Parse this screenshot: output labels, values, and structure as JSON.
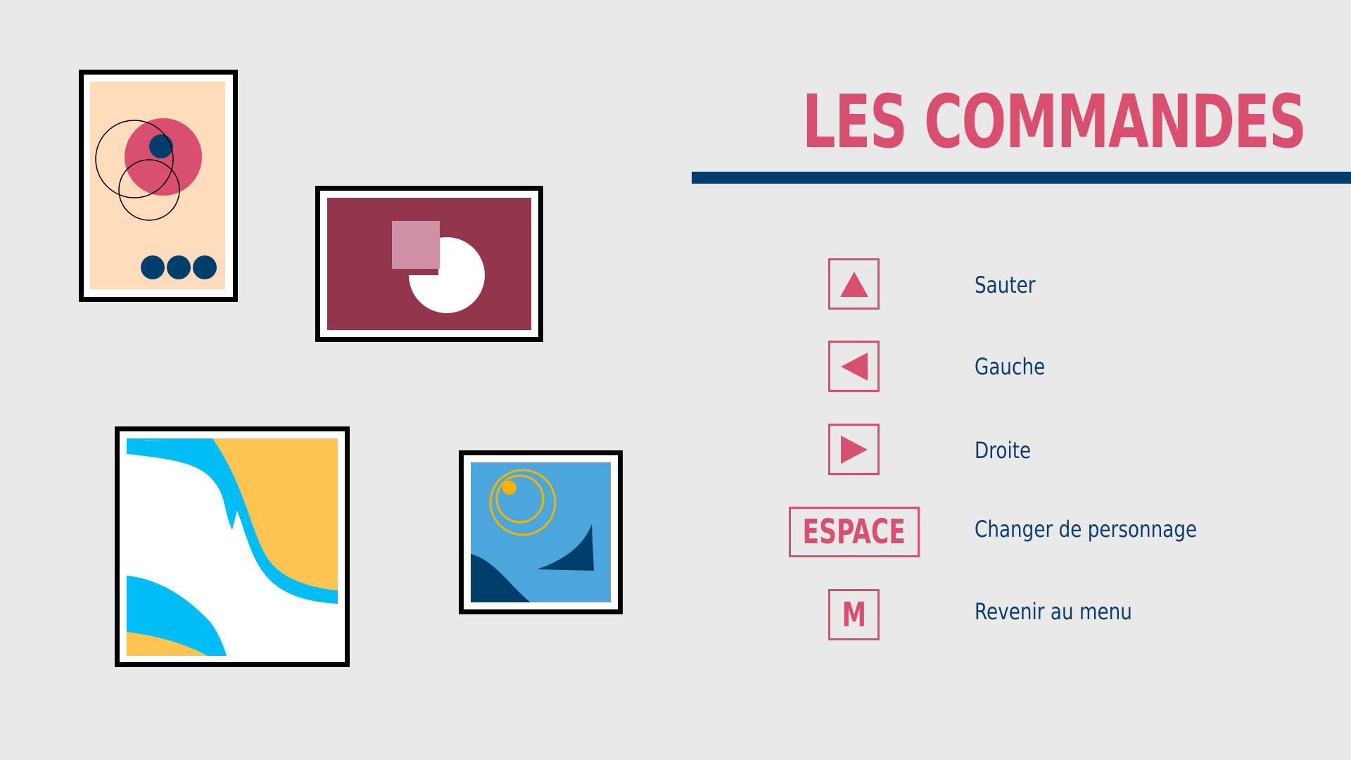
{
  "title": "LES COMMANDES",
  "colors": {
    "background": "#e9e9e9",
    "accent": "#d94f70",
    "navy": "#003f6b",
    "label": "#0d3d6b",
    "peach": "#ffdcbc",
    "wine": "#93354c",
    "sky": "#4ba6dc",
    "cyan": "#00bdf6",
    "yellow": "#ffc44f",
    "gold": "#f2b400"
  },
  "controls": [
    {
      "key": "",
      "icon": "up-triangle-icon",
      "action": "Sauter"
    },
    {
      "key": "",
      "icon": "left-triangle-icon",
      "action": "Gauche"
    },
    {
      "key": "",
      "icon": "right-triangle-icon",
      "action": "Droite"
    },
    {
      "key": "ESPACE",
      "icon": "",
      "action": "Changer de personnage"
    },
    {
      "key": "M",
      "icon": "",
      "action": "Revenir au menu"
    }
  ]
}
